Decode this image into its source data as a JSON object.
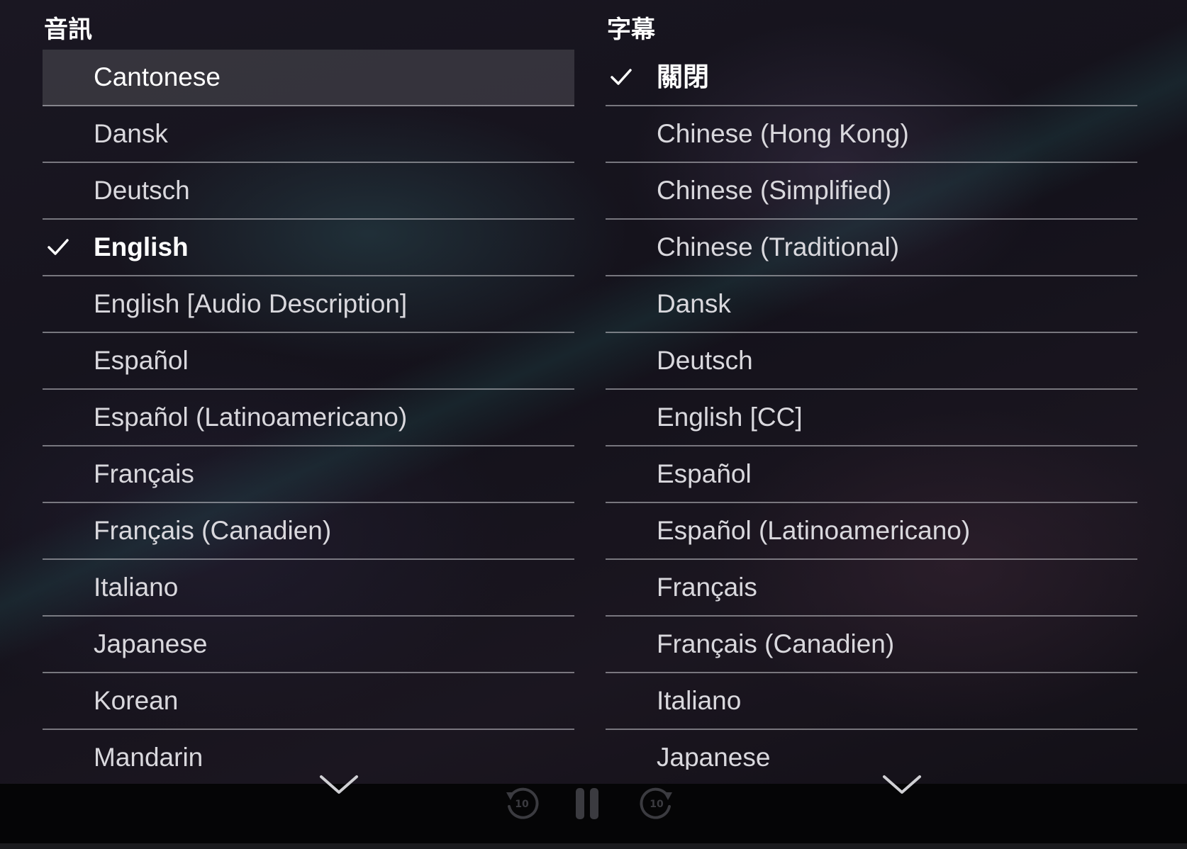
{
  "audio": {
    "title": "音訊",
    "items": [
      {
        "label": "Cantonese",
        "focused": true,
        "selected": false
      },
      {
        "label": "Dansk",
        "focused": false,
        "selected": false
      },
      {
        "label": "Deutsch",
        "focused": false,
        "selected": false
      },
      {
        "label": "English",
        "focused": false,
        "selected": true
      },
      {
        "label": "English [Audio Description]",
        "focused": false,
        "selected": false
      },
      {
        "label": "Español",
        "focused": false,
        "selected": false
      },
      {
        "label": "Español (Latinoamericano)",
        "focused": false,
        "selected": false
      },
      {
        "label": "Français",
        "focused": false,
        "selected": false
      },
      {
        "label": "Français (Canadien)",
        "focused": false,
        "selected": false
      },
      {
        "label": "Italiano",
        "focused": false,
        "selected": false
      },
      {
        "label": "Japanese",
        "focused": false,
        "selected": false
      },
      {
        "label": "Korean",
        "focused": false,
        "selected": false
      },
      {
        "label": "Mandarin",
        "focused": false,
        "selected": false
      }
    ]
  },
  "subtitles": {
    "title": "字幕",
    "items": [
      {
        "label": "關閉",
        "focused": false,
        "selected": true
      },
      {
        "label": "Chinese (Hong Kong)",
        "focused": false,
        "selected": false
      },
      {
        "label": "Chinese (Simplified)",
        "focused": false,
        "selected": false
      },
      {
        "label": "Chinese (Traditional)",
        "focused": false,
        "selected": false
      },
      {
        "label": "Dansk",
        "focused": false,
        "selected": false
      },
      {
        "label": "Deutsch",
        "focused": false,
        "selected": false
      },
      {
        "label": "English [CC]",
        "focused": false,
        "selected": false
      },
      {
        "label": "Español",
        "focused": false,
        "selected": false
      },
      {
        "label": "Español (Latinoamericano)",
        "focused": false,
        "selected": false
      },
      {
        "label": "Français",
        "focused": false,
        "selected": false
      },
      {
        "label": "Français (Canadien)",
        "focused": false,
        "selected": false
      },
      {
        "label": "Italiano",
        "focused": false,
        "selected": false
      },
      {
        "label": "Japanese",
        "focused": false,
        "selected": false
      }
    ]
  },
  "controls": {
    "rewind_label": "10",
    "forward_label": "10",
    "icons": {
      "rewind": "rewind-10-icon",
      "pause": "pause-icon",
      "forward": "forward-10-icon",
      "scroll_down": "chevron-down-icon",
      "check": "checkmark-icon"
    }
  },
  "colors": {
    "text_primary": "#ffffff",
    "text_secondary": "#d9d8dd",
    "divider": "#c8c8cd",
    "focus_highlight": "#3a3940",
    "controls_dim": "#3b3b40"
  }
}
